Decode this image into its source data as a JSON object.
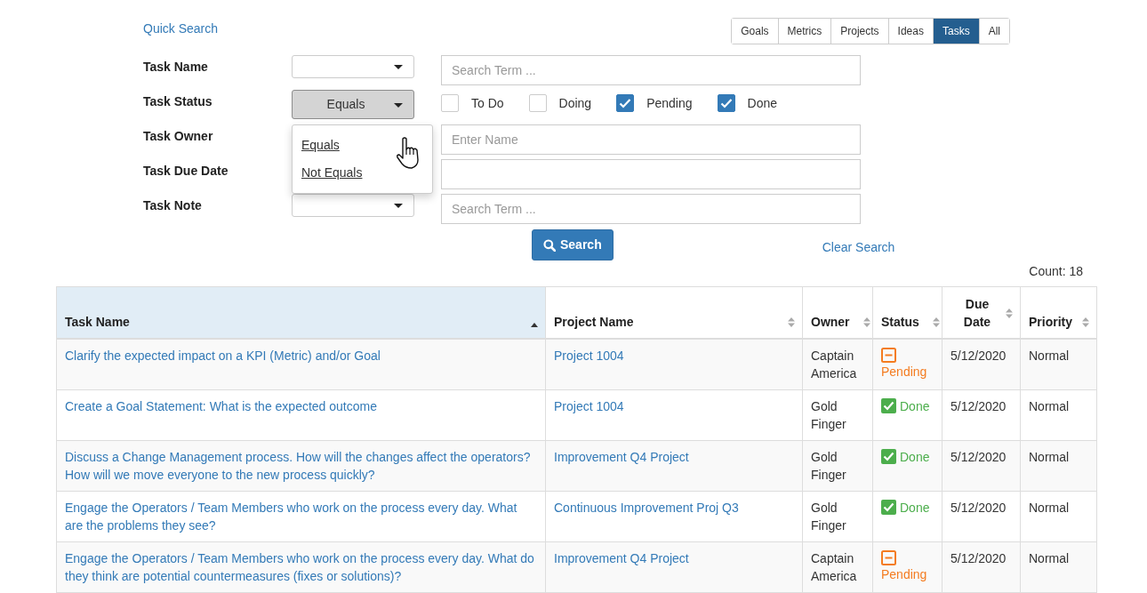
{
  "quick_search": "Quick Search",
  "type_tabs": [
    {
      "label": "Goals",
      "selected": false
    },
    {
      "label": "Metrics",
      "selected": false
    },
    {
      "label": "Projects",
      "selected": false
    },
    {
      "label": "Ideas",
      "selected": false
    },
    {
      "label": "Tasks",
      "selected": true
    },
    {
      "label": "All",
      "selected": false
    }
  ],
  "filters": [
    {
      "label": "Task Name",
      "kind": "text",
      "operator_select": true,
      "placeholder": "Search Term ..."
    },
    {
      "label": "Task Status",
      "kind": "checkboxes",
      "operator_select": true,
      "operator": "Equals",
      "expanded": true,
      "options": [
        "Equals",
        "Not Equals"
      ],
      "checkboxes": [
        {
          "label": "To Do",
          "checked": false
        },
        {
          "label": "Doing",
          "checked": false
        },
        {
          "label": "Pending",
          "checked": true
        },
        {
          "label": "Done",
          "checked": true
        }
      ]
    },
    {
      "label": "Task Owner",
      "kind": "text",
      "operator_select": false,
      "placeholder": "Enter Name"
    },
    {
      "label": "Task Due Date",
      "kind": "text",
      "operator_select": false
    },
    {
      "label": "Task Note",
      "kind": "text",
      "operator_select": true,
      "placeholder": "Search Term ..."
    }
  ],
  "search_button": "Search",
  "clear_search": "Clear Search",
  "count": "Count: 18",
  "table": {
    "columns": [
      {
        "label": "Task Name",
        "sorted": true
      },
      {
        "label": "Project Name",
        "sorted": false
      },
      {
        "label": "Owner",
        "sorted": false
      },
      {
        "label": "Status",
        "sorted": false
      },
      {
        "label": "Due Date",
        "sorted": false
      },
      {
        "label": "Priority",
        "sorted": false
      }
    ],
    "rows": [
      {
        "task": "Clarify the expected impact on a KPI (Metric) and/or Goal",
        "project": "Project 1004",
        "owner": "Captain America",
        "status": {
          "kind": "pending",
          "label": "Pending"
        },
        "due": "5/12/2020",
        "priority": "Normal"
      },
      {
        "task": "Create a Goal Statement: What is the expected outcome",
        "project": "Project 1004",
        "owner": "Gold Finger",
        "status": {
          "kind": "done",
          "label": "Done"
        },
        "due": "5/12/2020",
        "priority": "Normal"
      },
      {
        "task": "Discuss a Change Management process. How will the changes affect the operators? How will we move everyone to the new process quickly?",
        "project": "Improvement Q4 Project",
        "owner": "Gold Finger",
        "status": {
          "kind": "done",
          "label": "Done"
        },
        "due": "5/12/2020",
        "priority": "Normal"
      },
      {
        "task": "Engage the Operators / Team Members who work on the process every day. What are the problems they see?",
        "project": "Continuous Improvement Proj Q3",
        "owner": "Gold Finger",
        "status": {
          "kind": "done",
          "label": "Done"
        },
        "due": "5/12/2020",
        "priority": "Normal"
      },
      {
        "task": "Engage the Operators / Team Members who work on the process every day. What do they think are potential countermeasures (fixes or solutions)?",
        "project": "Improvement Q4 Project",
        "owner": "Captain America",
        "status": {
          "kind": "pending",
          "label": "Pending"
        },
        "due": "5/12/2020",
        "priority": "Normal"
      }
    ]
  }
}
